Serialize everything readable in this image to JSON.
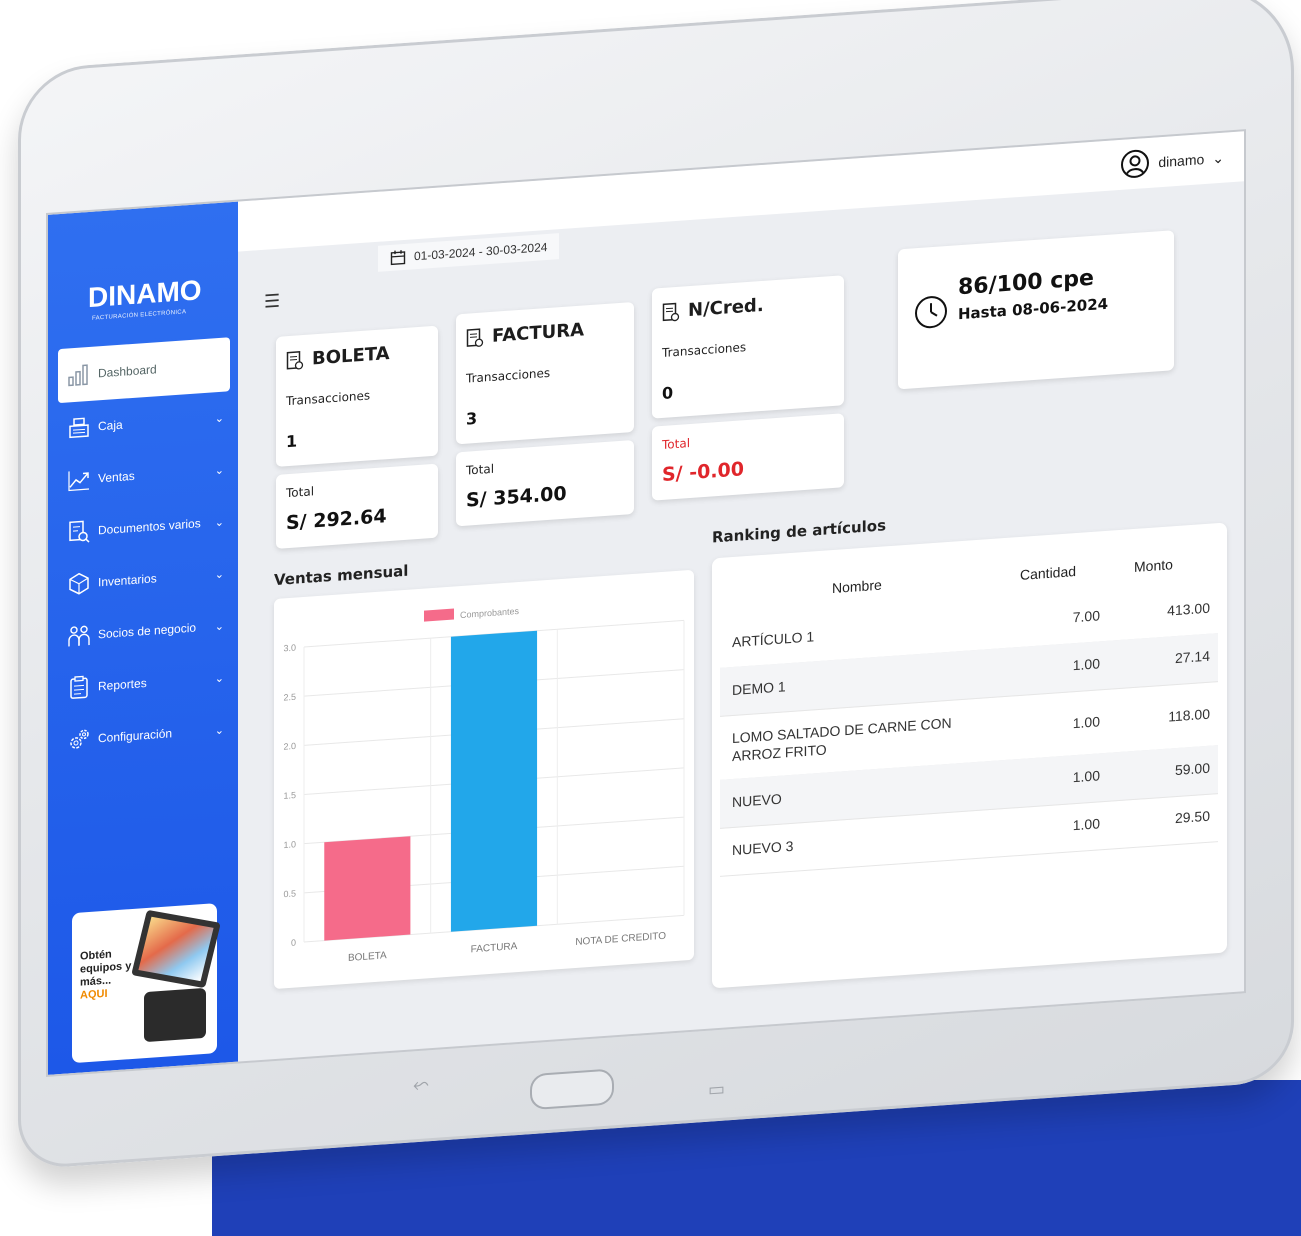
{
  "brand": {
    "logo": "DINAMO",
    "tagline": "FACTURACIÓN ELECTRÓNICA"
  },
  "header": {
    "date_range": "01-03-2024 - 30-03-2024",
    "user": "dinamo"
  },
  "sidebar": {
    "items": [
      {
        "label": "Dashboard",
        "icon": "bar-chart-icon",
        "active": true
      },
      {
        "label": "Caja",
        "icon": "cash-register-icon"
      },
      {
        "label": "Ventas",
        "icon": "trend-icon"
      },
      {
        "label": "Documentos varios",
        "icon": "document-search-icon"
      },
      {
        "label": "Inventarios",
        "icon": "box-icon"
      },
      {
        "label": "Socios de negocio",
        "icon": "people-icon"
      },
      {
        "label": "Reportes",
        "icon": "clipboard-icon"
      },
      {
        "label": "Configuración",
        "icon": "gears-icon"
      }
    ],
    "promo": {
      "line1": "Obtén",
      "line2": "equipos y",
      "line3": "más...",
      "cta": "AQUI"
    }
  },
  "cards": {
    "boleta": {
      "title": "BOLETA",
      "sub": "Transacciones",
      "count": "1",
      "total_label": "Total",
      "total": "S/ 292.64"
    },
    "factura": {
      "title": "FACTURA",
      "sub": "Transacciones",
      "count": "3",
      "total_label": "Total",
      "total": "S/ 354.00"
    },
    "ncred": {
      "title": "N/Cred.",
      "sub": "Transacciones",
      "count": "0",
      "total_label": "Total",
      "total": "S/ -0.00"
    },
    "cpe": {
      "count": "86/100 cpe",
      "until": "Hasta 08-06-2024"
    }
  },
  "colors": {
    "sidebar": "#2f6ff0",
    "negative": "#e0262b",
    "bar_boleta": "#f56b8a",
    "bar_factura": "#22a7ea"
  },
  "sections": {
    "chart_title": "Ventas mensual",
    "ranking_title": "Ranking de artículos"
  },
  "chart_data": {
    "type": "bar",
    "title": "",
    "legend": "Comprobantes",
    "categories": [
      "BOLETA",
      "FACTURA",
      "NOTA DE CREDITO"
    ],
    "series": [
      {
        "name": "Comprobantes",
        "values": [
          1,
          3,
          0
        ]
      }
    ],
    "ylim": [
      0,
      3.0
    ],
    "yticks": [
      "3.0",
      "2.5",
      "2.0",
      "1.5",
      "1.0",
      "0.5",
      "0"
    ],
    "grid": true,
    "legend_position": "top"
  },
  "ranking": {
    "headers": {
      "name": "Nombre",
      "qty": "Cantidad",
      "amount": "Monto"
    },
    "rows": [
      {
        "name": "ARTÍCULO 1",
        "qty": "7.00",
        "amount": "413.00"
      },
      {
        "name": "DEMO 1",
        "qty": "1.00",
        "amount": "27.14"
      },
      {
        "name": "LOMO SALTADO DE CARNE CON ARROZ FRITO",
        "qty": "1.00",
        "amount": "118.00"
      },
      {
        "name": "NUEVO",
        "qty": "1.00",
        "amount": "59.00"
      },
      {
        "name": "NUEVO 3",
        "qty": "1.00",
        "amount": "29.50"
      }
    ]
  }
}
